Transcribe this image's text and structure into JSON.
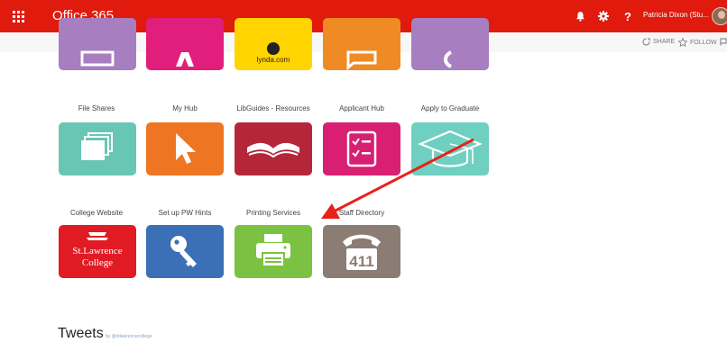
{
  "topbar": {
    "title": "Office 365",
    "help_label": "?",
    "user_name": "Patricia Dixon (Stu..."
  },
  "actions": {
    "share_label": "SHARE",
    "follow_label": "FOLLOW"
  },
  "tiles_top": [
    {
      "color": "#a77ebf"
    },
    {
      "color": "#e21e7c"
    },
    {
      "color": "#ffd400",
      "logo_text": "lynda.com"
    },
    {
      "color": "#f08a24"
    },
    {
      "color": "#a77ebf"
    }
  ],
  "tiles_row1": [
    {
      "label": "File Shares",
      "color": "#68c6b4",
      "icon": "folders-icon"
    },
    {
      "label": "My Hub",
      "color": "#ee7622",
      "icon": "cursor-icon"
    },
    {
      "label": "LibGuides - Resources",
      "color": "#b6263b",
      "icon": "open-book-icon"
    },
    {
      "label": "Applicant Hub",
      "color": "#d81f72",
      "icon": "checklist-icon"
    },
    {
      "label": "Apply to Graduate",
      "color": "#6fcfc0",
      "icon": "graduation-cap-icon"
    }
  ],
  "tiles_row2": [
    {
      "label": "College Website",
      "color": "#e01b24",
      "icon": "college-logo",
      "logo_line1": "St.Lawrence",
      "logo_line2": "College"
    },
    {
      "label": "Set up PW Hints",
      "color": "#3b6fb6",
      "icon": "key-icon"
    },
    {
      "label": "Printing Services",
      "color": "#7cc242",
      "icon": "printer-icon"
    },
    {
      "label": "Staff Directory",
      "color": "#8b7d73",
      "icon": "phone-icon",
      "icon_text": "411"
    }
  ],
  "annotation": {
    "color": "#e8211a"
  },
  "tweets": {
    "title": "Tweets",
    "by": "by @stlawrencecollege"
  }
}
